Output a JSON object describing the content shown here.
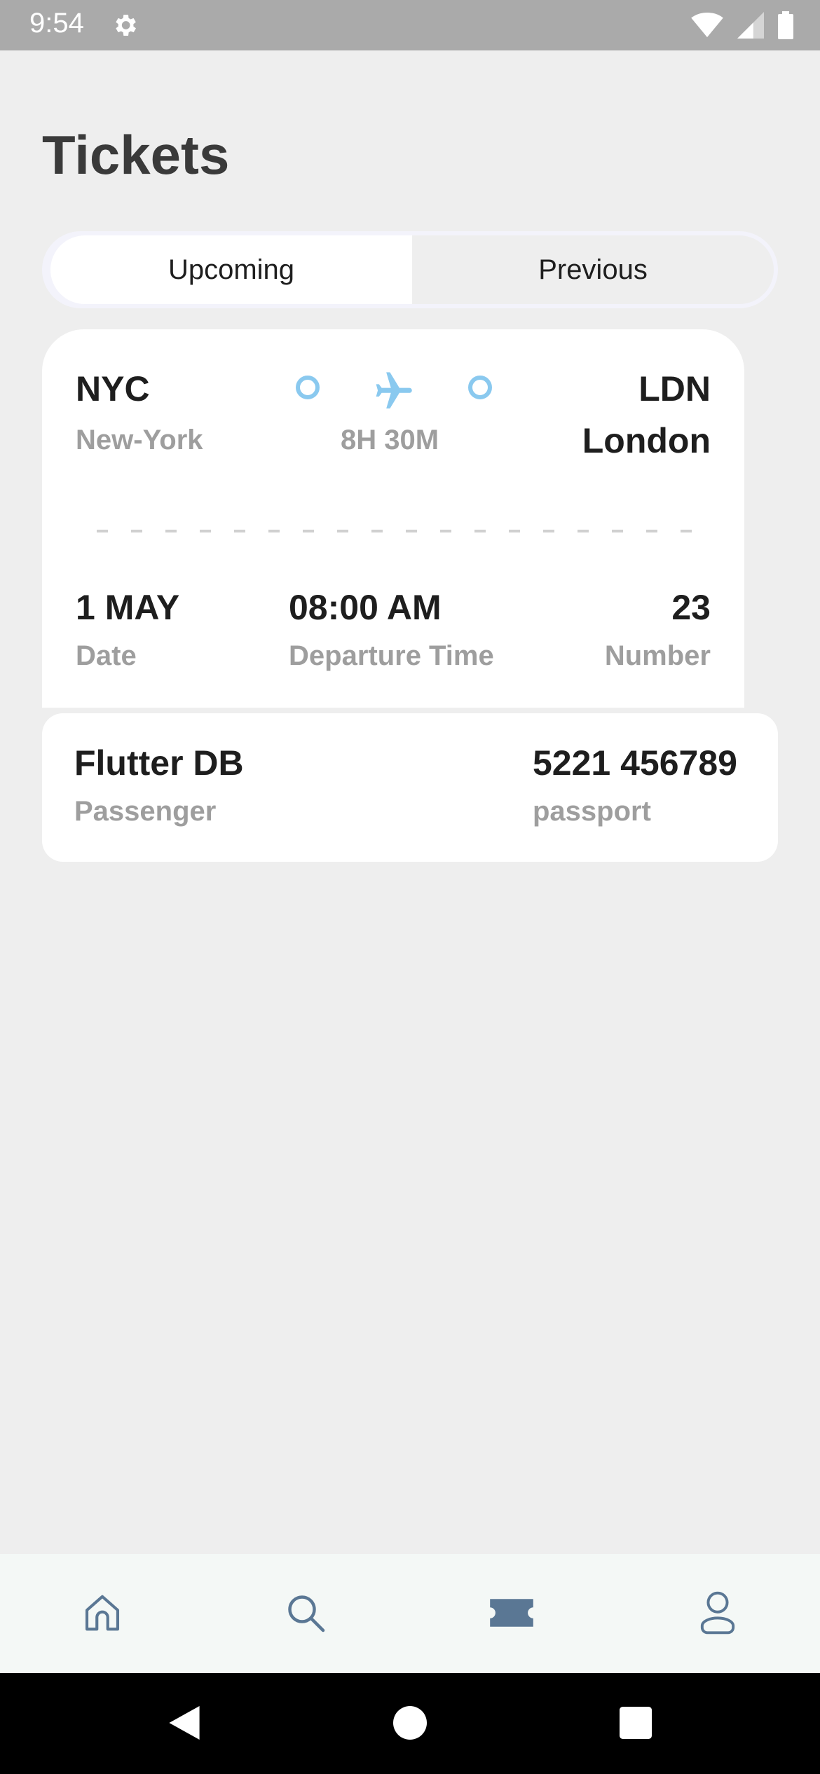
{
  "status_bar": {
    "time": "9:54"
  },
  "page": {
    "title": "Tickets"
  },
  "tabs": [
    {
      "label": "Upcoming",
      "active": true
    },
    {
      "label": "Previous",
      "active": false
    }
  ],
  "ticket": {
    "from_code": "NYC",
    "from_city": "New-York",
    "to_code": "LDN",
    "to_city": "London",
    "duration": "8H 30M",
    "date_value": "1 MAY",
    "date_label": "Date",
    "time_value": "08:00 AM",
    "time_label": "Departure Time",
    "number_value": "23",
    "number_label": "Number"
  },
  "passenger": {
    "name": "Flutter DB",
    "name_label": "Passenger",
    "passport": "5221 456789",
    "passport_label": "passport"
  },
  "bottom_nav": [
    {
      "icon": "home-icon",
      "active": false
    },
    {
      "icon": "search-icon",
      "active": false
    },
    {
      "icon": "ticket-icon",
      "active": true
    },
    {
      "icon": "profile-icon",
      "active": false
    }
  ],
  "colors": {
    "accent_blue": "#8ac9ef",
    "nav_icon": "#5a7794",
    "background": "#eeeeee"
  }
}
